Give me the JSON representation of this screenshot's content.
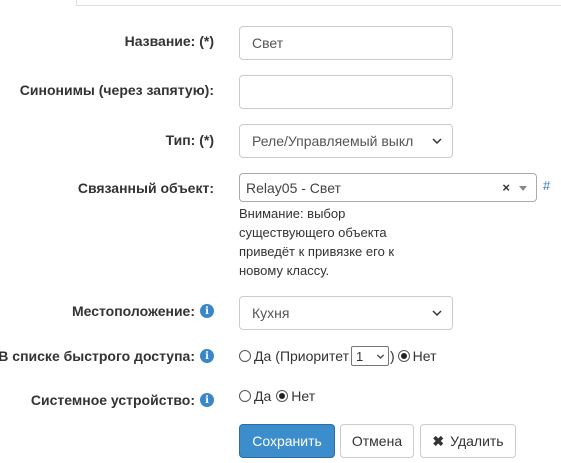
{
  "form": {
    "name": {
      "label": "Название: (*)",
      "value": "Свет"
    },
    "synonyms": {
      "label": "Синонимы (через запятую):",
      "value": ""
    },
    "type": {
      "label": "Тип: (*)",
      "value": "Реле/Управляемый выкл"
    },
    "linked_object": {
      "label": "Связанный объект:",
      "value": "Relay05 - Свет",
      "clear": "×",
      "hash": "#",
      "note_lines": [
        "Внимание: выбор",
        "существующего объекта",
        "приведёт к привязке его к",
        "новому классу."
      ]
    },
    "location": {
      "label": "Местоположение:",
      "value": "Кухня"
    },
    "quick_access": {
      "label": "В списке быстрого доступа:",
      "yes": "Да",
      "priority_prefix": "(Приоритет",
      "priority_value": "1",
      "priority_suffix": ")",
      "no": "Нет",
      "selected": "no"
    },
    "system_device": {
      "label": "Системное устройство:",
      "yes": "Да",
      "no": "Нет",
      "selected": "no"
    },
    "info_glyph": "i"
  },
  "buttons": {
    "save": "Сохранить",
    "cancel": "Отмена",
    "delete": "Удалить",
    "delete_icon_glyph": "✖"
  },
  "colors": {
    "primary": "#3c8dcc",
    "info": "#3a87c8",
    "link": "#337ab7"
  }
}
